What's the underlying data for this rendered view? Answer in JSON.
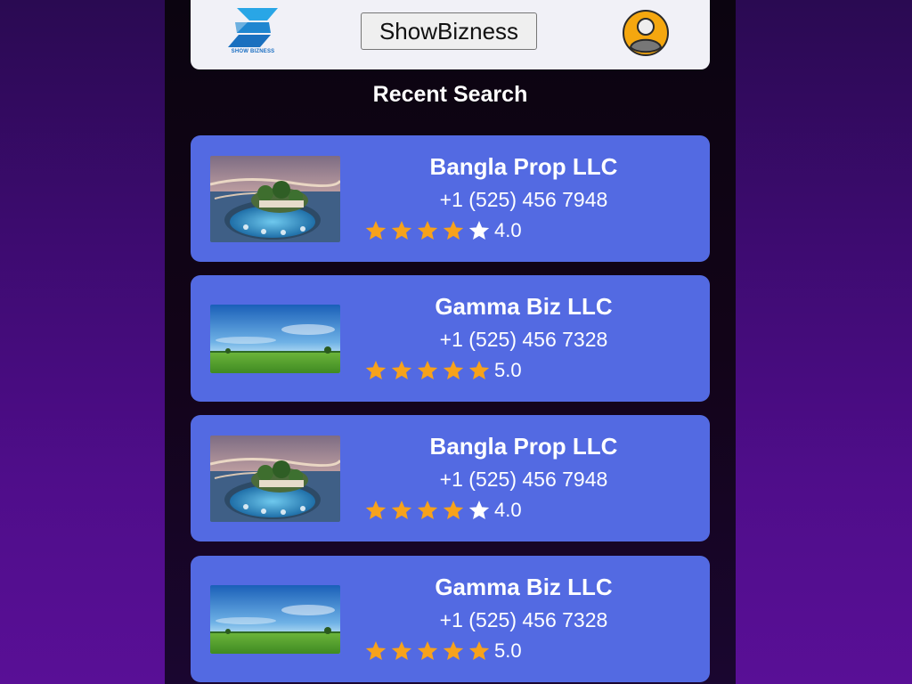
{
  "header": {
    "logo_text": "SHOW BIZNESS",
    "brand_button_label": "ShowBizness",
    "logo_icon": "s-logo-icon",
    "profile_icon": "user-avatar-icon"
  },
  "section": {
    "title": "Recent Search"
  },
  "colors": {
    "card_bg": "#536ae2",
    "star_filled": "#f7a21b",
    "star_empty": "#ffffff",
    "avatar_ring": "#f5a70f"
  },
  "results": [
    {
      "name": "Bangla Prop LLC",
      "phone": "+1 (525) 456 7948",
      "rating": 4,
      "rating_label": "4.0",
      "image": "resort-island-image"
    },
    {
      "name": "Gamma Biz LLC",
      "phone": "+1 (525) 456 7328",
      "rating": 5,
      "rating_label": "5.0",
      "image": "green-field-sky-image"
    },
    {
      "name": "Bangla Prop LLC",
      "phone": "+1 (525) 456 7948",
      "rating": 4,
      "rating_label": "4.0",
      "image": "resort-island-image"
    },
    {
      "name": "Gamma Biz LLC",
      "phone": "+1 (525) 456 7328",
      "rating": 5,
      "rating_label": "5.0",
      "image": "green-field-sky-image"
    }
  ]
}
